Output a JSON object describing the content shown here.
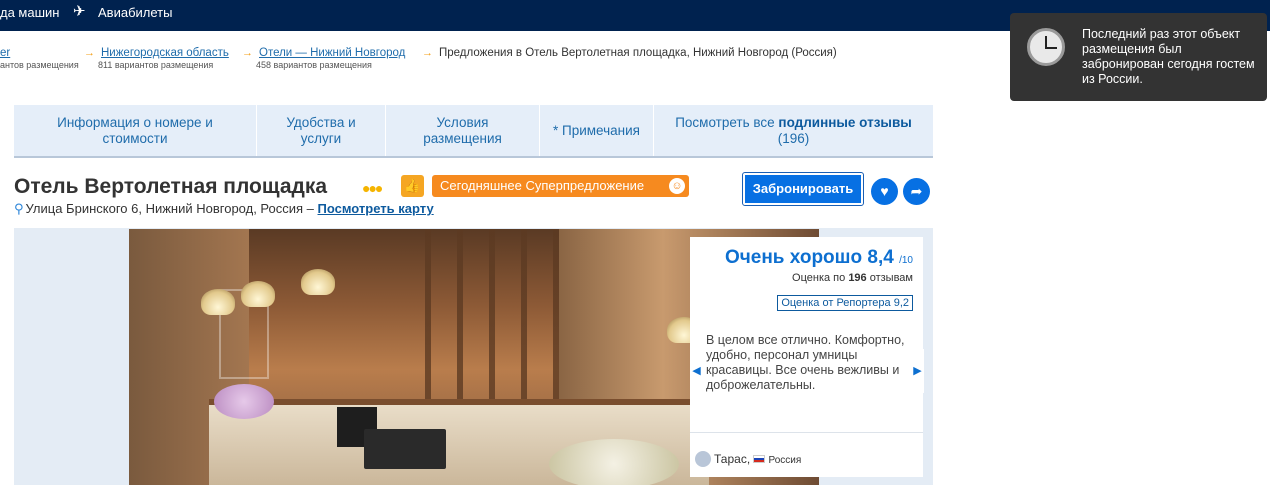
{
  "topnav": {
    "cars_label": "да машин",
    "flights_label": "Авиабилеты"
  },
  "breadcrumbs": [
    {
      "label": "er",
      "sub": "антов размещения"
    },
    {
      "label": "Нижегородская область",
      "sub": "811 вариантов размещения"
    },
    {
      "label": "Отели — Нижний Новгород",
      "sub": "458 вариантов размещения"
    },
    {
      "label": "Предложения в Отель Вертолетная площадка, Нижний Новгород (Россия)"
    }
  ],
  "tabs": [
    {
      "label": "Информация о номере и стоимости"
    },
    {
      "label": "Удобства и услуги"
    },
    {
      "label": "Условия размещения"
    },
    {
      "label": "* Примечания"
    },
    {
      "label_prefix": "Посмотреть все ",
      "label_bold": "подлинные отзывы",
      "count": "(196)"
    }
  ],
  "hotel": {
    "name": "Отель Вертолетная площадка",
    "stars": "●●●",
    "deal_label": "Сегодняшнее Суперпредложение",
    "book_label": "Забронировать",
    "address": "Улица Бринского 6, Нижний Новгород, Россия – ",
    "map_link": "Посмотреть карту"
  },
  "review": {
    "rating_label": "Очень хорошо",
    "score": "8,4",
    "score_max": "/10",
    "count_prefix": "Оценка по ",
    "count": "196",
    "count_suffix": " отзывам",
    "reporter": "Оценка от Репортера 9,2",
    "quote": "В целом все отлично. Комфортно, удобно, персонал умницы красавицы. Все очень вежливы и доброжелательны.",
    "author": "Тарас,",
    "country": "Россия"
  },
  "toast": {
    "message": "Последний раз этот объект размещения был забронирован сегодня гостем из России."
  },
  "icons": [
    "plane-icon",
    "thumbs-up-icon",
    "deal-badge-icon",
    "heart-icon",
    "share-icon",
    "map-pin-icon",
    "clock-icon",
    "chevron-left-icon",
    "chevron-right-icon",
    "avatar-icon",
    "flag-icon"
  ],
  "colors": {
    "nav_bg": "#00224f",
    "accent": "#0770e3",
    "deal": "#f68a1f",
    "toast_bg": "#333333"
  }
}
